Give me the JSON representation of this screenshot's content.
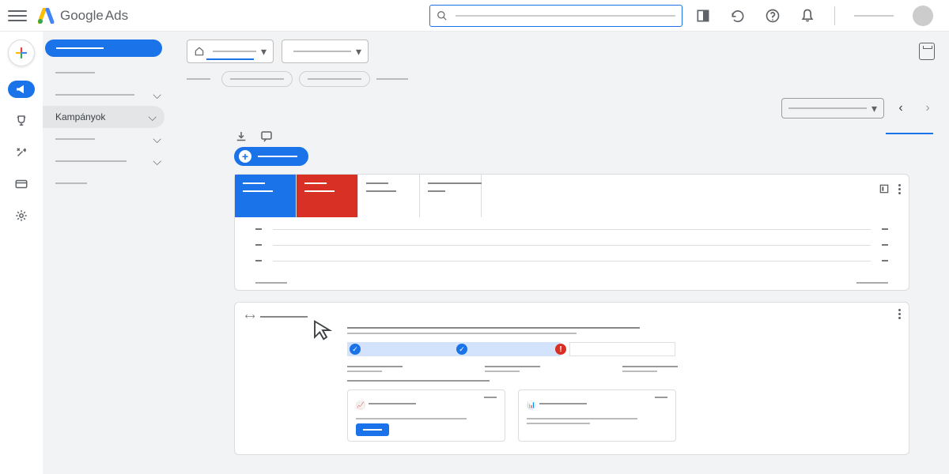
{
  "brand": {
    "name": "Google",
    "product": "Ads"
  },
  "colors": {
    "primary": "#1a73e8",
    "danger": "#d93025",
    "bg": "#f1f3f4"
  },
  "header": {
    "search_placeholder": "",
    "icons": [
      "appearance-icon",
      "refresh-icon",
      "help-icon",
      "notifications-icon"
    ]
  },
  "rail": {
    "items": [
      {
        "id": "create",
        "icon": "plus-multicolor-icon"
      },
      {
        "id": "campaigns",
        "icon": "megaphone-icon",
        "active": true
      },
      {
        "id": "goals",
        "icon": "trophy-icon"
      },
      {
        "id": "tools",
        "icon": "tools-icon"
      },
      {
        "id": "billing",
        "icon": "card-icon"
      },
      {
        "id": "admin",
        "icon": "gear-icon"
      }
    ]
  },
  "sidebar": {
    "create_label": "",
    "items": [
      {
        "label": "",
        "type": "plain"
      },
      {
        "label": "",
        "type": "expandable"
      },
      {
        "label": "Kampányok",
        "type": "expandable-active"
      },
      {
        "label": "",
        "type": "expandable-sub"
      },
      {
        "label": "",
        "type": "expandable-sub2"
      },
      {
        "label": "",
        "type": "plain-sub"
      }
    ]
  },
  "scope": {
    "selector1": "",
    "selector2": ""
  },
  "chips": {
    "count": 2,
    "trailing_label": ""
  },
  "date_range": {
    "label": ""
  },
  "toolbar": {
    "download": "download-icon",
    "feedback": "feedback-icon"
  },
  "new_button": {
    "label": ""
  },
  "perf": {
    "tiles": [
      {
        "color": "blue",
        "metric": "",
        "value": ""
      },
      {
        "color": "red",
        "metric": "",
        "value": ""
      },
      {
        "color": "plain",
        "metric": "",
        "value": ""
      },
      {
        "color": "plain",
        "metric": "",
        "value": ""
      }
    ],
    "lines": 3,
    "footer_left": "",
    "footer_right": "",
    "icons": [
      "expand-icon",
      "more-icon"
    ]
  },
  "recommendations": {
    "title": "",
    "headline": "",
    "subhead": "",
    "progress": [
      {
        "state": "done"
      },
      {
        "state": "done"
      },
      {
        "state": "error"
      },
      {
        "state": "empty"
      }
    ],
    "columns": 3,
    "tiles": [
      {
        "icon": "trend-icon",
        "color": "orange",
        "title": "",
        "body": "",
        "cta": ""
      },
      {
        "icon": "chart-icon",
        "color": "blue",
        "title": "",
        "body": ""
      }
    ]
  }
}
